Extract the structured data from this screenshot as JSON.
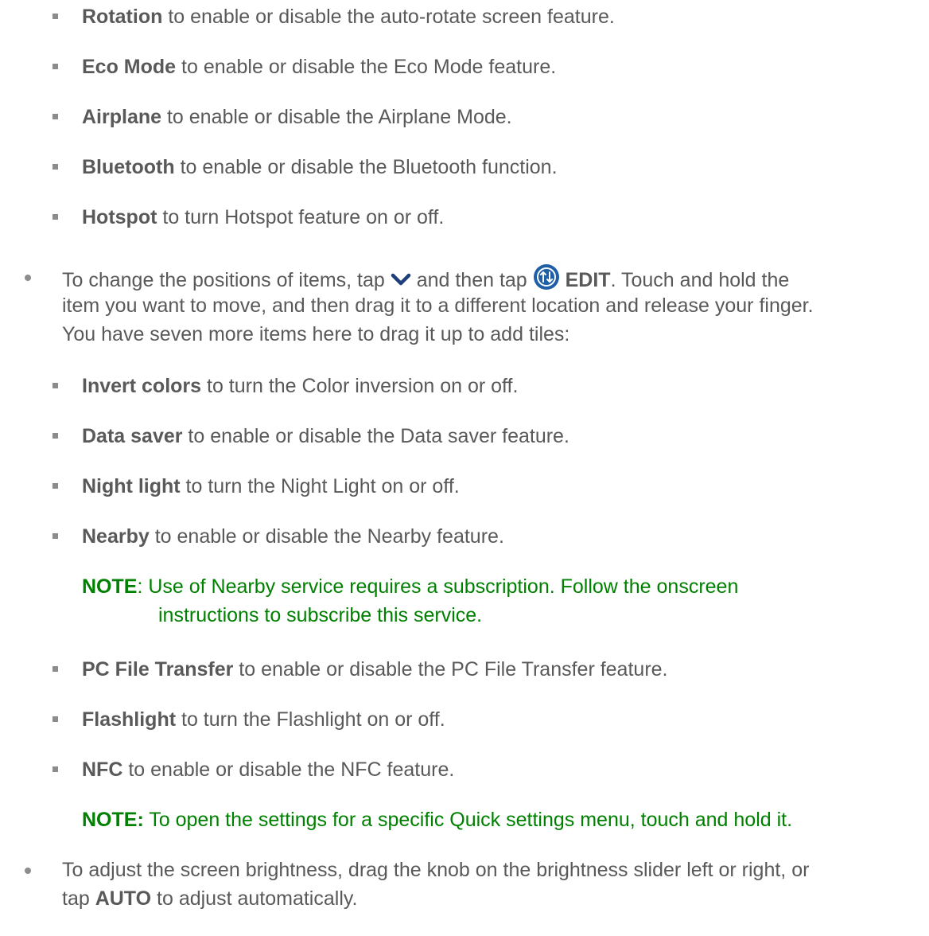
{
  "list1": [
    {
      "term": "Rotation",
      "desc": " to enable or disable the auto-rotate screen feature."
    },
    {
      "term": "Eco Mode",
      "desc": " to enable or disable the Eco Mode feature."
    },
    {
      "term": "Airplane",
      "desc": " to enable or disable the Airplane Mode."
    },
    {
      "term": "Bluetooth",
      "desc": " to enable or disable the Bluetooth function."
    },
    {
      "term": "Hotspot",
      "desc": " to turn Hotspot feature on or off."
    }
  ],
  "bullet_edit": {
    "l1_a": "To change the positions of items, tap ",
    "l1_b": " and then tap ",
    "l1_edit": "EDIT",
    "l1_c": ". Touch and hold the",
    "l2": "item you want to move, and then drag it to a different location and release your finger.",
    "l3": "You have seven more items here to drag it up to add tiles:",
    "chevron_icon": "chevron-down-icon",
    "edit_icon": "edit-arrows-icon",
    "edit_icon_color": "#1f5fa8"
  },
  "list2": [
    {
      "term": "Invert colors",
      "desc": " to turn the Color inversion on or off."
    },
    {
      "term": "Data saver",
      "desc": " to enable or disable the Data saver feature."
    },
    {
      "term": "Night light",
      "desc": " to turn the Night Light on or off."
    },
    {
      "term": "Nearby",
      "desc": " to enable or disable the Nearby feature."
    }
  ],
  "note1": {
    "label": "NOTE",
    "l1": ": Use of Nearby service requires a subscription. Follow the onscreen",
    "l2": "instructions to subscribe this service."
  },
  "list3": [
    {
      "term": "PC File Transfer",
      "desc": " to enable or disable the PC File Transfer feature."
    },
    {
      "term": "Flashlight",
      "desc": " to turn the Flashlight on or off."
    },
    {
      "term": "NFC",
      "desc": " to enable or disable the NFC feature."
    }
  ],
  "note2": {
    "label": "NOTE:",
    "text": " To open the settings for a specific Quick settings menu, touch and hold it."
  },
  "bullet_brightness": {
    "l1": "To adjust the screen brightness, drag the knob on the brightness slider left or right, or",
    "l2_a": "tap ",
    "l2_auto": "AUTO",
    "l2_b": " to adjust automatically."
  },
  "colors": {
    "text": "#595959",
    "note": "#008000",
    "icon_blue": "#1f5fa8"
  }
}
